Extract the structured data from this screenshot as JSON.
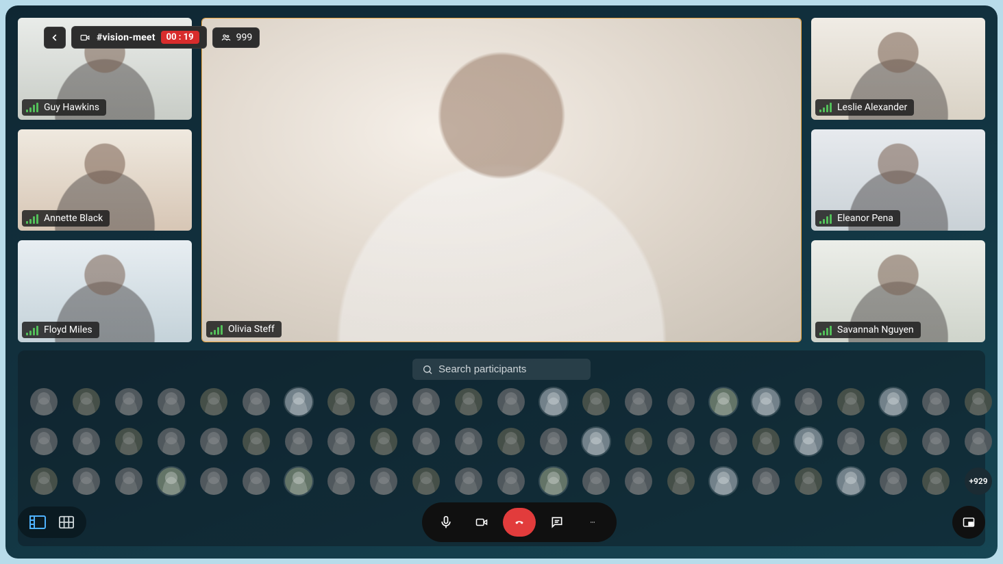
{
  "header": {
    "channel_name": "#vision-meet",
    "timer": "00 : 19",
    "participant_count": "999"
  },
  "main_speaker": {
    "name": "Olivia Steff"
  },
  "left_tiles": [
    {
      "name": "Guy Hawkins"
    },
    {
      "name": "Annette Black"
    },
    {
      "name": "Floyd Miles"
    }
  ],
  "right_tiles": [
    {
      "name": "Leslie Alexander"
    },
    {
      "name": "Eleanor Pena"
    },
    {
      "name": "Savannah Nguyen"
    }
  ],
  "search": {
    "placeholder": "Search participants"
  },
  "overflow_label": "+929",
  "icons": {
    "back": "chevron-left-icon",
    "video": "video-icon",
    "people": "people-icon",
    "search": "search-icon",
    "layout_speaker": "speaker-layout-icon",
    "layout_grid": "grid-layout-icon",
    "mic": "microphone-icon",
    "cam": "camera-icon",
    "end": "end-call-icon",
    "chat": "chat-icon",
    "more": "more-icon",
    "pip": "picture-in-picture-icon"
  }
}
